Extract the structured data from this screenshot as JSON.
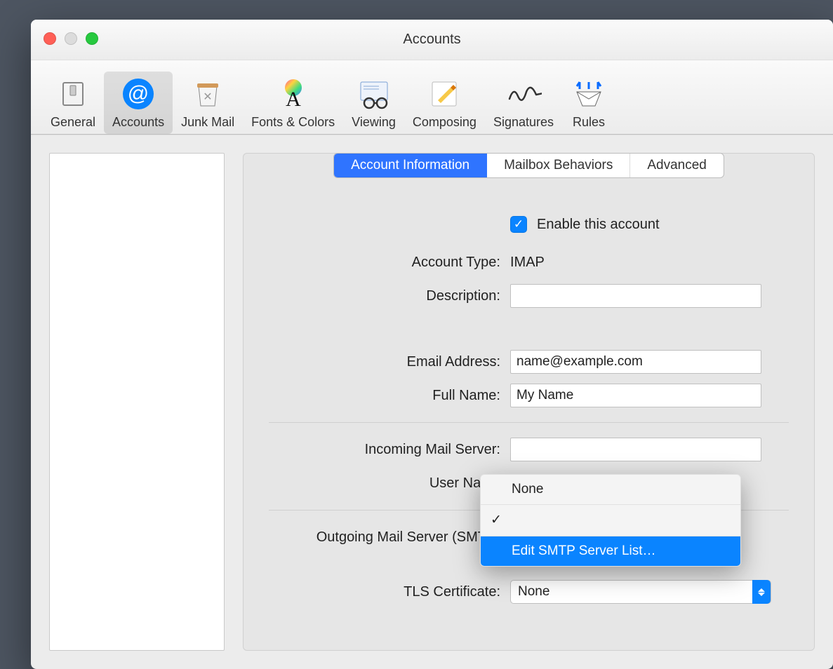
{
  "window": {
    "title": "Accounts"
  },
  "toolbar": {
    "items": [
      {
        "label": "General"
      },
      {
        "label": "Accounts"
      },
      {
        "label": "Junk Mail"
      },
      {
        "label": "Fonts & Colors"
      },
      {
        "label": "Viewing"
      },
      {
        "label": "Composing"
      },
      {
        "label": "Signatures"
      },
      {
        "label": "Rules"
      }
    ]
  },
  "tabs": {
    "account_info": "Account Information",
    "mailbox_behaviors": "Mailbox Behaviors",
    "advanced": "Advanced"
  },
  "form": {
    "enable_label": "Enable this account",
    "account_type_label": "Account Type:",
    "account_type_value": "IMAP",
    "description_label": "Description:",
    "description_value": "",
    "email_label": "Email Address:",
    "email_value": "name@example.com",
    "fullname_label": "Full Name:",
    "fullname_value": "My Name",
    "incoming_label": "Incoming Mail Server:",
    "incoming_value": "",
    "username_label": "User Name",
    "outgoing_label": "Outgoing Mail Server (SMTP)",
    "tls_label": "TLS Certificate:",
    "tls_value": "None"
  },
  "smtp_menu": {
    "none": "None",
    "selected": "",
    "edit": "Edit SMTP Server List…"
  }
}
